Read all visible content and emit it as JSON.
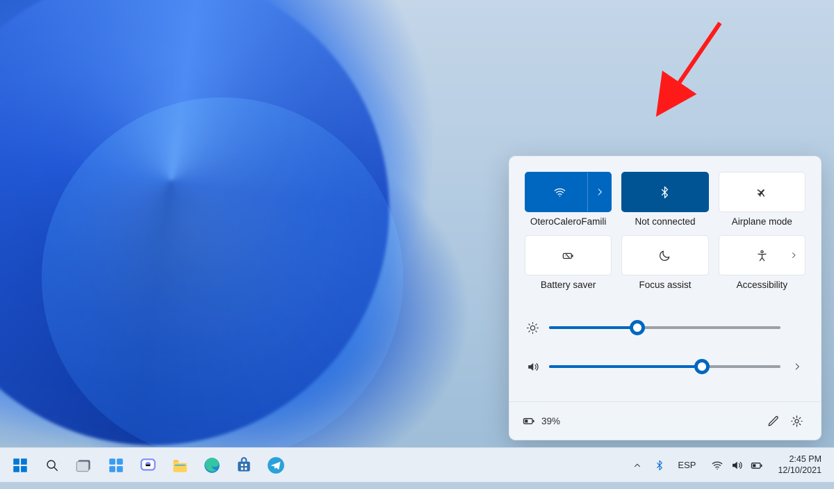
{
  "colors": {
    "accent": "#0067c0",
    "accent_dark": "#005494"
  },
  "annotation": {
    "arrow_color": "#ff1a1a"
  },
  "quick_settings": {
    "tiles": [
      {
        "id": "wifi",
        "label": "OteroCaleroFamili",
        "active": true,
        "has_chevron": true
      },
      {
        "id": "bluetooth",
        "label": "Not connected",
        "active": true
      },
      {
        "id": "airplane",
        "label": "Airplane mode",
        "active": false
      },
      {
        "id": "battery_saver",
        "label": "Battery saver",
        "active": false
      },
      {
        "id": "focus_assist",
        "label": "Focus assist",
        "active": false
      },
      {
        "id": "accessibility",
        "label": "Accessibility",
        "active": false,
        "has_chevron_inline": true
      }
    ],
    "brightness_percent": 38,
    "volume_percent": 66,
    "footer": {
      "battery_text": "39%"
    }
  },
  "taskbar": {
    "system_tray": {
      "language": "ESP",
      "time": "2:45 PM",
      "date": "12/10/2021"
    }
  }
}
